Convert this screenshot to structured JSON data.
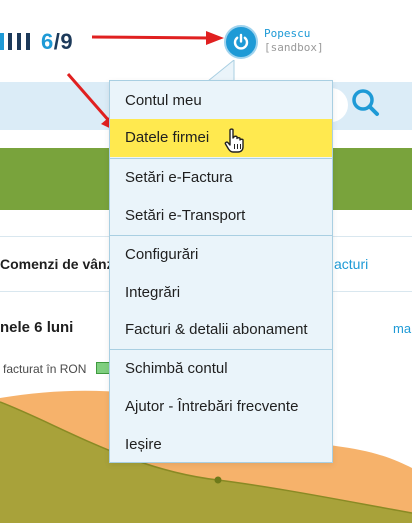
{
  "header": {
    "progress": {
      "current": "6",
      "separator": "/",
      "total": "9"
    },
    "user": {
      "name": "Popescu",
      "environment": "[sandbox]",
      "icon": "power-icon"
    }
  },
  "page": {
    "tabs": {
      "left_label": "Comenzi de vânz",
      "right_label": "acturi"
    },
    "section_title": "nele 6 luni",
    "section_link": "ma",
    "legend_label": "facturat în RON",
    "search_icon": "search-icon"
  },
  "menu": {
    "items": [
      {
        "label": "Contul meu"
      },
      {
        "label": "Datele firmei"
      },
      {
        "label": "Setări e-Factura"
      },
      {
        "label": "Setări e-Transport"
      },
      {
        "label": "Configurări"
      },
      {
        "label": "Integrări"
      },
      {
        "label": "Facturi & detalii abonament"
      },
      {
        "label": "Schimbă contul"
      },
      {
        "label": "Ajutor - Întrebări frecvente"
      },
      {
        "label": "Ieșire"
      }
    ],
    "highlighted_item": "Datele firmei"
  },
  "colors": {
    "accent": "#1e9ad6",
    "navy": "#1d3a5a",
    "highlight": "#ffe94f",
    "menu_bg": "#eaf4fa",
    "green_band": "#79a33c",
    "arrow": "#e02020",
    "chart_orange": "#f6b26b",
    "chart_olive": "#a8a23a"
  }
}
